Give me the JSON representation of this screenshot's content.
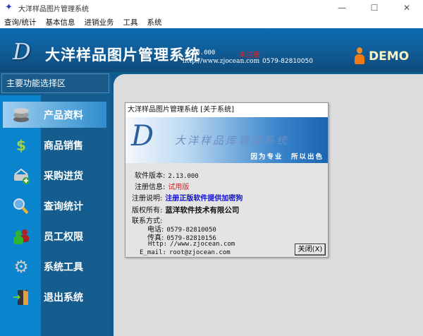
{
  "window": {
    "title": "大洋样品图片管理系统",
    "minimize": "—",
    "maximize": "☐",
    "close": "✕"
  },
  "menu": [
    "查询/统计",
    "基本信息",
    "进销业务",
    "工具",
    "系统"
  ],
  "header": {
    "logo": "D",
    "app_name": "大洋样品图片管理系统",
    "version": "2.13.000",
    "status": "未注册",
    "url": "http://www.zjocean.com",
    "phone": "0579-82810050",
    "user": "DEMO"
  },
  "sidebar": {
    "title": "主要功能选择区",
    "items": [
      {
        "label": "产品资料",
        "icon": "database-icon",
        "active": true
      },
      {
        "label": "商品销售",
        "icon": "dollar-icon"
      },
      {
        "label": "采购进货",
        "icon": "basket-add-icon"
      },
      {
        "label": "查询统计",
        "icon": "magnifier-icon"
      },
      {
        "label": "员工权限",
        "icon": "users-icon"
      },
      {
        "label": "系统工具",
        "icon": "gear-icon"
      },
      {
        "label": "退出系统",
        "icon": "exit-door-icon"
      }
    ]
  },
  "dialog": {
    "title": "大洋样品图片管理系统 [关于系统]",
    "banner_name": "大洋样品库管理系统",
    "slogan": "因为专业　所以出色",
    "version_label": "软件版本:",
    "version": "2.13.000",
    "reg_label": "注册信息:",
    "reg": "试用版",
    "note_label": "注册说明:",
    "note": "注册正版软件提供加密狗",
    "copyright_label": "版权所有:",
    "copyright": "蓝洋软件技术有限公司",
    "contact_label": "联系方式:",
    "tel_label": "电话:",
    "tel": "0579-82810050",
    "fax_label": "传真:",
    "fax": "0579-82810156",
    "http_label": "Http:",
    "http": "//www.zjocean.com",
    "email_label": "E_mail:",
    "email": "root@zjocean.com",
    "close_label": "关闭(X)"
  },
  "colors": {
    "accent": "#0a84cc",
    "sidebar": "#155d8e",
    "reg": "#e21f1f",
    "note": "#1010d0"
  }
}
